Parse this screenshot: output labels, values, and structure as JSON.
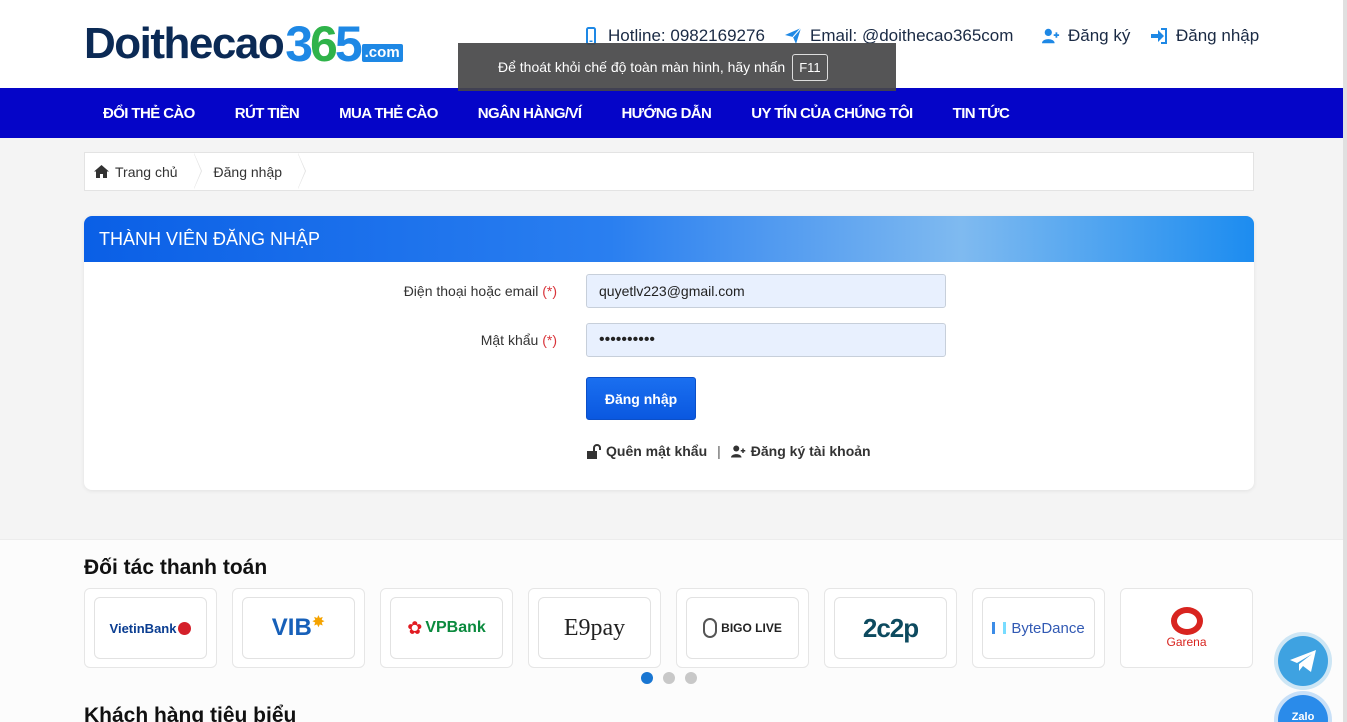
{
  "logo": {
    "main": "Doithecao",
    "num_a": "3",
    "num_b": "6",
    "num_c": "5",
    "com": ".com"
  },
  "topbar": {
    "hotline": "Hotline: 0982169276",
    "email": "Email: @doithecao365com",
    "register": "Đăng ký",
    "login": "Đăng nhập"
  },
  "toast": {
    "text": "Để thoát khỏi chế độ toàn màn hình, hãy nhấn",
    "key": "F11"
  },
  "nav": [
    "Đổi thẻ cào",
    "Rút tiền",
    "Mua thẻ cào",
    "Ngân hàng/Ví",
    "Hướng dẫn",
    "Uy tín của chúng tôi",
    "Tin tức"
  ],
  "breadcrumb": {
    "home": "Trang chủ",
    "current": "Đăng nhập"
  },
  "login_card": {
    "title": "Thành viên đăng nhập",
    "phone_label": "Điện thoại hoặc email",
    "password_label": "Mật khẩu",
    "required": "(*)",
    "phone_value": "quyetlv223@gmail.com",
    "password_value": "••••••••••",
    "submit": "Đăng nhập",
    "forgot": "Quên mật khẩu",
    "separator": "|",
    "register": "Đăng ký tài khoản"
  },
  "partners": {
    "title": "Đối tác thanh toán",
    "logos": [
      "VietinBank",
      "VIB",
      "VPBank",
      "E9pay",
      "BIGO LIVE",
      "2c2p",
      "ByteDance",
      "Garena"
    ],
    "page_count": 3,
    "active_page": 1
  },
  "customers": {
    "title": "Khách hàng tiêu biểu"
  },
  "floating": {
    "zalo": "Zalo"
  },
  "colors": {
    "nav_bg": "#0505c8",
    "accent": "#1e88e5",
    "required": "#d9343a"
  }
}
